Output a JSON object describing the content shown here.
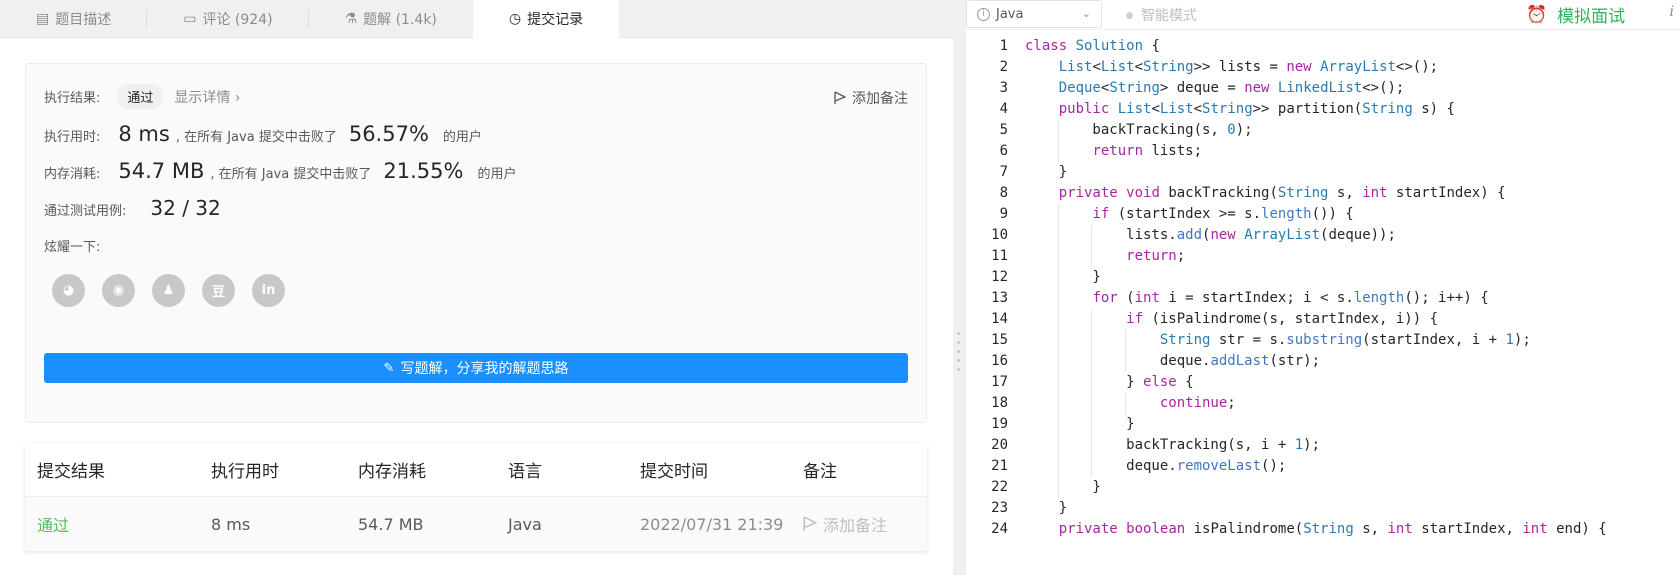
{
  "tabs": [
    {
      "label": "题目描述",
      "icon": "document-icon"
    },
    {
      "label": "评论 (924)",
      "icon": "comment-icon"
    },
    {
      "label": "题解 (1.4k)",
      "icon": "flask-icon"
    },
    {
      "label": "提交记录",
      "icon": "clock-icon"
    }
  ],
  "result": {
    "result_label": "执行结果:",
    "status": "通过",
    "details": "显示详情 ›",
    "add_note": "添加备注",
    "time_label": "执行用时:",
    "time_value": "8 ms",
    "time_text": ", 在所有 Java 提交中击败了",
    "time_pct": "56.57%",
    "users": "的用户",
    "mem_label": "内存消耗:",
    "mem_value": "54.7 MB",
    "mem_text": ", 在所有 Java 提交中击败了",
    "mem_pct": "21.55%",
    "cases_label": "通过测试用例:",
    "cases_value": "32  /  32",
    "share_label": "炫耀一下:",
    "write_button": "写题解，分享我的解题思路"
  },
  "shares": [
    {
      "name": "wechat-icon",
      "glyph": "◕"
    },
    {
      "name": "weibo-icon",
      "glyph": "◉"
    },
    {
      "name": "qq-icon",
      "glyph": "♟"
    },
    {
      "name": "douban-icon",
      "glyph": "豆"
    },
    {
      "name": "linkedin-icon",
      "glyph": "in"
    }
  ],
  "table": {
    "headers": [
      "提交结果",
      "执行用时",
      "内存消耗",
      "语言",
      "提交时间",
      "备注"
    ],
    "row": [
      "通过",
      "8 ms",
      "54.7 MB",
      "Java",
      "2022/07/31 21:39",
      "添加备注"
    ]
  },
  "editor": {
    "language": "Java",
    "mode": "智能模式",
    "mock_interview": "模拟面试",
    "info": "i"
  },
  "colors": {
    "accent": "#1a90ff",
    "success": "#5cb85c",
    "mock": "#2db55d",
    "keyword": "#a626a4",
    "type": "#2a7ab0",
    "number": "#2a7ab0",
    "method": "#4078c0"
  },
  "code_lines": [
    "class Solution {",
    "    List<List<String>> lists = new ArrayList<>();",
    "    Deque<String> deque = new LinkedList<>();",
    "    public List<List<String>> partition(String s) {",
    "        backTracking(s, 0);",
    "        return lists;",
    "    }",
    "    private void backTracking(String s, int startIndex) {",
    "        if (startIndex >= s.length()) {",
    "            lists.add(new ArrayList(deque));",
    "            return;",
    "        }",
    "        for (int i = startIndex; i < s.length(); i++) {",
    "            if (isPalindrome(s, startIndex, i)) {",
    "                String str = s.substring(startIndex, i + 1);",
    "                deque.addLast(str);",
    "            } else {",
    "                continue;",
    "            }",
    "            backTracking(s, i + 1);",
    "            deque.removeLast();",
    "        }",
    "    }",
    "    private boolean isPalindrome(String s, int startIndex, int end) {"
  ]
}
